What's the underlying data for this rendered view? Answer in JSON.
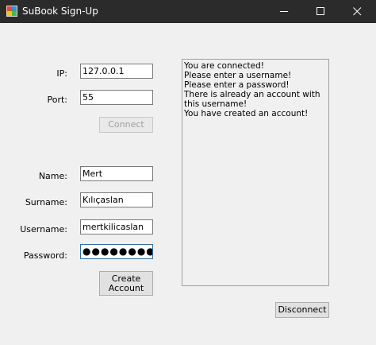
{
  "window": {
    "title": "SuBook Sign-Up"
  },
  "connection": {
    "ip_label": "IP:",
    "ip_value": "127.0.0.1",
    "port_label": "Port:",
    "port_value": "55",
    "connect_label": "Connect"
  },
  "signup": {
    "name_label": "Name:",
    "name_value": "Mert",
    "surname_label": "Surname:",
    "surname_value": "Kılıçaslan",
    "username_label": "Username:",
    "username_value": "mertkilicaslan",
    "password_label": "Password:",
    "password_value": "●●●●●●●●",
    "create_label": "Create Account"
  },
  "log": {
    "text": "You are connected!\nPlease enter a username!\nPlease enter a password!\nThere is already an account with this username!\nYou have created an account!"
  },
  "disconnect_label": "Disconnect",
  "icons": {
    "app": "app-icon",
    "minimize": "minimize-icon",
    "maximize": "maximize-icon",
    "close": "close-icon"
  },
  "colors": {
    "titlebar": "#2b2b2b",
    "focus_border": "#0078d7"
  }
}
